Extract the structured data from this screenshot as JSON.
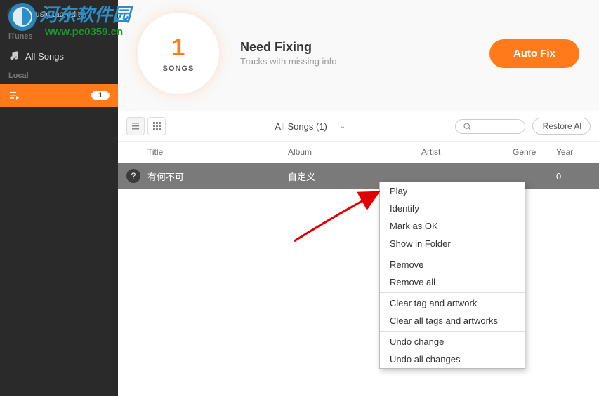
{
  "app": {
    "title": "music tag editor"
  },
  "watermark": {
    "text": "河东软件园",
    "url": "www.pc0359.cn"
  },
  "sidebar": {
    "section_itunes": "iTunes",
    "item_all_songs": "All Songs",
    "section_local": "Local",
    "local_item": "",
    "local_badge": "1"
  },
  "header": {
    "songs_count": "1",
    "songs_label": "SONGS",
    "need_fixing_title": "Need Fixing",
    "need_fixing_sub": "Tracks with missing info.",
    "autofix": "Auto Fix"
  },
  "toolbar": {
    "songs_dropdown": "All Songs (1)",
    "restore": "Restore Al"
  },
  "columns": {
    "title": "Title",
    "album": "Album",
    "artist": "Artist",
    "genre": "Genre",
    "year": "Year"
  },
  "rows": [
    {
      "title": "有何不可",
      "album": "自定义",
      "artist": "",
      "genre": "",
      "year": "0"
    }
  ],
  "context_menu": {
    "play": "Play",
    "identify": "Identify",
    "mark_ok": "Mark as OK",
    "show_folder": "Show in Folder",
    "remove": "Remove",
    "remove_all": "Remove all",
    "clear_tag": "Clear tag and artwork",
    "clear_all_tags": "Clear all tags and artworks",
    "undo_change": "Undo change",
    "undo_all": "Undo all changes"
  }
}
